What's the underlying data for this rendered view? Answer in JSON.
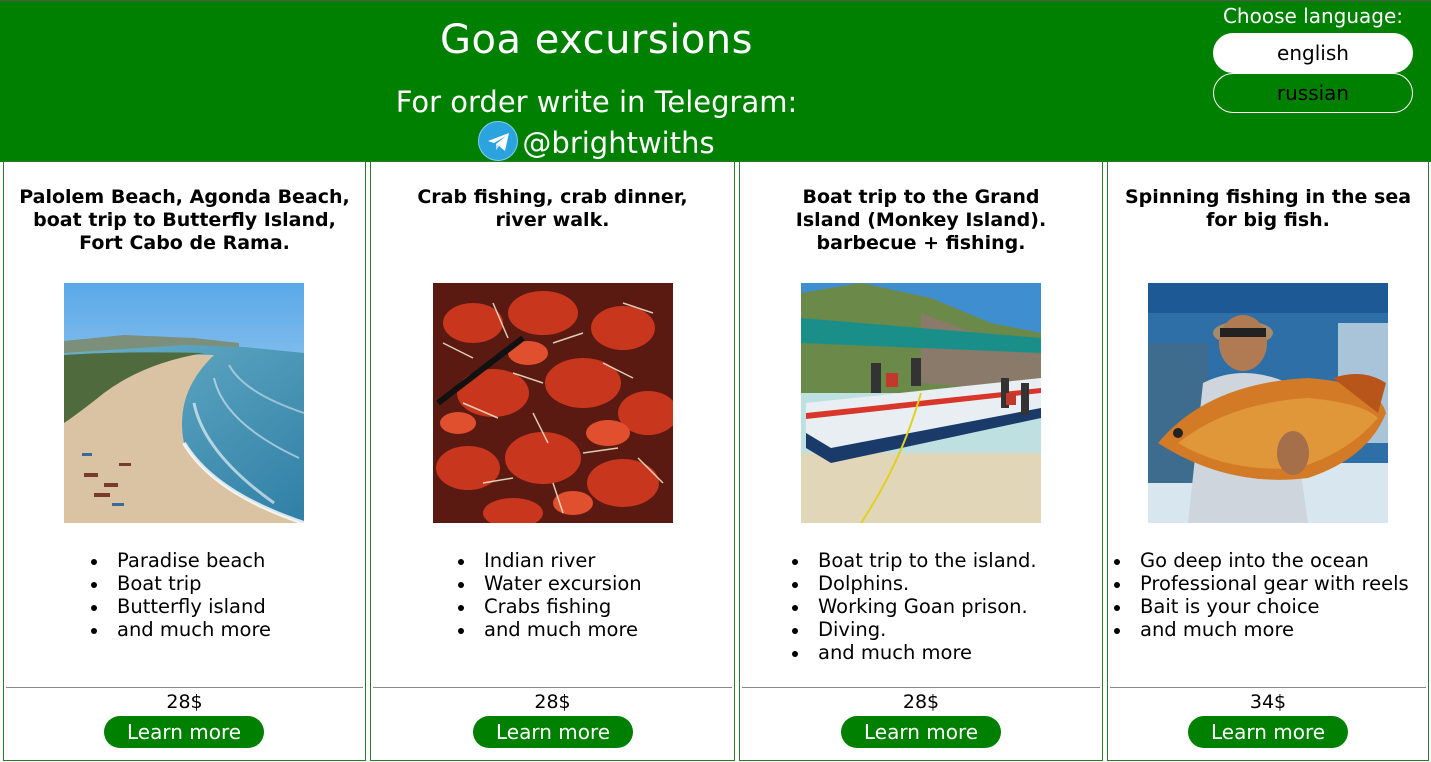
{
  "header": {
    "title": "Goa excursions",
    "order_text": "For order write in Telegram:",
    "telegram_handle": "@brightwiths",
    "telegram_icon": "telegram-icon",
    "background_color": "#008000"
  },
  "language": {
    "title": "Choose language:",
    "options": [
      "english",
      "russian"
    ],
    "selected": "english"
  },
  "cards": [
    {
      "title": "Palolem Beach, Agonda Beach, boat trip to Butterfly Island, Fort Cabo de Rama.",
      "image": "beach-photo",
      "features": [
        "Paradise beach",
        "Boat trip",
        "Butterfly island",
        "and much more"
      ],
      "price": "28$",
      "button": "Learn more"
    },
    {
      "title": "Crab fishing, crab dinner, river walk.",
      "image": "crabs-photo",
      "features": [
        "Indian river",
        "Water excursion",
        "Crabs fishing",
        "and much more"
      ],
      "price": "28$",
      "button": "Learn more"
    },
    {
      "title_line1": "Boat trip to the Grand Island (Monkey Island).",
      "title_line2": "barbecue + fishing.",
      "image": "boat-photo",
      "features": [
        "Boat trip to the island.",
        "Dolphins.",
        "Working Goan prison.",
        "Diving.",
        "and much more"
      ],
      "price": "28$",
      "button": "Learn more"
    },
    {
      "title": "Spinning fishing in the sea for big fish.",
      "image": "fisherman-photo",
      "features": [
        "Go deep into the ocean",
        "Professional gear with reels",
        "Bait is your choice",
        "and much more"
      ],
      "price": "34$",
      "button": "Learn more"
    }
  ]
}
